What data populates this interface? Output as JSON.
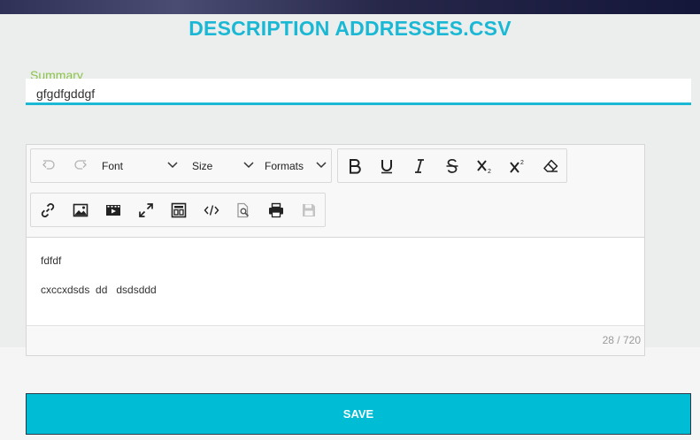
{
  "header": {
    "title": "DESCRIPTION ADDRESSES.CSV"
  },
  "summary": {
    "label": "Summary",
    "value": "gfgdfgddgf"
  },
  "editor": {
    "toolbar": {
      "font_label": "Font",
      "size_label": "Size",
      "formats_label": "Formats",
      "icons": [
        "undo-icon",
        "redo-icon",
        "bold-icon",
        "underline-icon",
        "italic-icon",
        "strikethrough-icon",
        "subscript-icon",
        "superscript-icon",
        "clear-formatting-icon",
        "link-icon",
        "image-icon",
        "media-icon",
        "fullscreen-icon",
        "template-icon",
        "source-code-icon",
        "preview-icon",
        "print-icon",
        "save-icon"
      ]
    },
    "content": {
      "line1": "fdfdf",
      "line2": "cxccxdsds  dd   dsdsddd"
    },
    "char_count": "28 / 720"
  },
  "actions": {
    "save_label": "SAVE"
  },
  "colors": {
    "accent": "#1ab8d4",
    "label_green": "#8bc34a",
    "button": "#00bcd4"
  }
}
